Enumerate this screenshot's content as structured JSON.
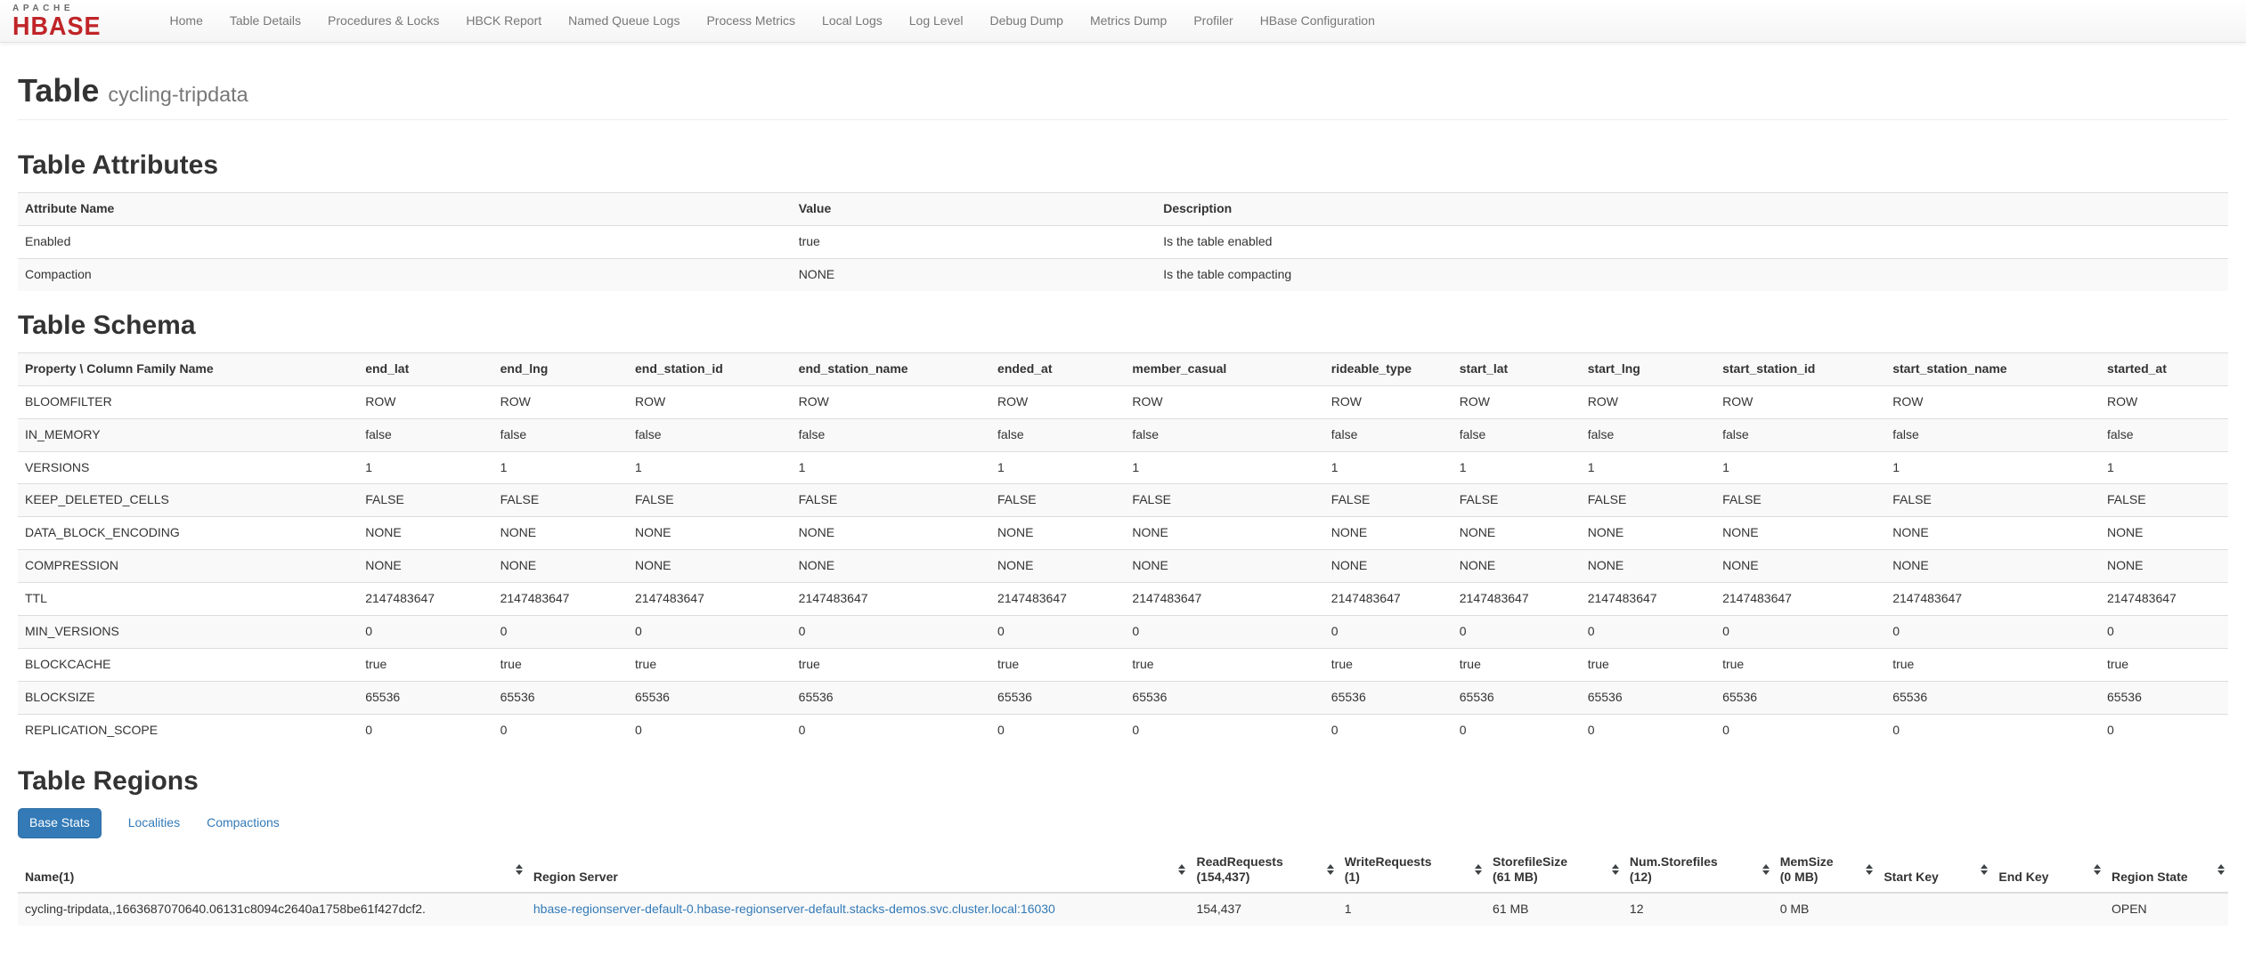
{
  "nav": {
    "brand_top": "APACHE",
    "brand_bottom": "HBASE",
    "items": [
      "Home",
      "Table Details",
      "Procedures & Locks",
      "HBCK Report",
      "Named Queue Logs",
      "Process Metrics",
      "Local Logs",
      "Log Level",
      "Debug Dump",
      "Metrics Dump",
      "Profiler",
      "HBase Configuration"
    ]
  },
  "page": {
    "title": "Table",
    "subtitle": "cycling-tripdata"
  },
  "attributes": {
    "heading": "Table Attributes",
    "columns": [
      "Attribute Name",
      "Value",
      "Description"
    ],
    "rows": [
      [
        "Enabled",
        "true",
        "Is the table enabled"
      ],
      [
        "Compaction",
        "NONE",
        "Is the table compacting"
      ]
    ]
  },
  "schema": {
    "heading": "Table Schema",
    "corner_header": "Property \\ Column Family Name",
    "families": [
      "end_lat",
      "end_lng",
      "end_station_id",
      "end_station_name",
      "ended_at",
      "member_casual",
      "rideable_type",
      "start_lat",
      "start_lng",
      "start_station_id",
      "start_station_name",
      "started_at"
    ],
    "rows": [
      {
        "property": "BLOOMFILTER",
        "value": "ROW"
      },
      {
        "property": "IN_MEMORY",
        "value": "false"
      },
      {
        "property": "VERSIONS",
        "value": "1"
      },
      {
        "property": "KEEP_DELETED_CELLS",
        "value": "FALSE"
      },
      {
        "property": "DATA_BLOCK_ENCODING",
        "value": "NONE"
      },
      {
        "property": "COMPRESSION",
        "value": "NONE"
      },
      {
        "property": "TTL",
        "value": "2147483647"
      },
      {
        "property": "MIN_VERSIONS",
        "value": "0"
      },
      {
        "property": "BLOCKCACHE",
        "value": "true"
      },
      {
        "property": "BLOCKSIZE",
        "value": "65536"
      },
      {
        "property": "REPLICATION_SCOPE",
        "value": "0"
      }
    ]
  },
  "regions": {
    "heading": "Table Regions",
    "tabs": [
      {
        "label": "Base Stats",
        "active": true
      },
      {
        "label": "Localities",
        "active": false
      },
      {
        "label": "Compactions",
        "active": false
      }
    ],
    "columns": [
      "Name(1)",
      "Region Server",
      "ReadRequests\n(154,437)",
      "WriteRequests\n(1)",
      "StorefileSize\n(61 MB)",
      "Num.Storefiles\n(12)",
      "MemSize\n(0 MB)",
      "Start Key",
      "End Key",
      "Region State"
    ],
    "rows": [
      {
        "name": "cycling-tripdata,,1663687070640.06131c8094c2640a1758be61f427dcf2.",
        "region_server": "hbase-regionserver-default-0.hbase-regionserver-default.stacks-demos.svc.cluster.local:16030",
        "read_requests": "154,437",
        "write_requests": "1",
        "storefile_size": "61 MB",
        "num_storefiles": "12",
        "mem_size": "0 MB",
        "start_key": "",
        "end_key": "",
        "region_state": "OPEN"
      }
    ]
  },
  "colors": {
    "accent_blue": "#337ab7",
    "brand_red": "#c02428",
    "stripe": "#f9f9f9",
    "table_border": "#dddddd",
    "nav_text": "#777777"
  }
}
